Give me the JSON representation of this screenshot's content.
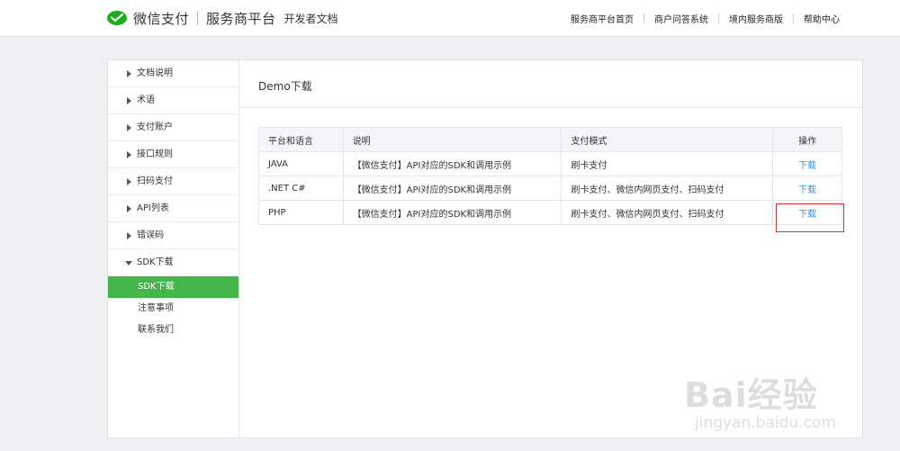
{
  "header": {
    "brand": "微信支付",
    "platform": "服务商平台",
    "docs": "开发者文档",
    "nav": [
      "服务商平台首页",
      "商户问答系统",
      "境内服务商版",
      "帮助中心"
    ]
  },
  "sidebar": {
    "items": [
      {
        "label": "文档说明"
      },
      {
        "label": "术语"
      },
      {
        "label": "支付账户"
      },
      {
        "label": "接口规则"
      },
      {
        "label": "扫码支付"
      },
      {
        "label": "API列表"
      },
      {
        "label": "错误码"
      },
      {
        "label": "SDK下载"
      }
    ],
    "sub_items": [
      {
        "label": "SDK下载"
      },
      {
        "label": "注意事项"
      },
      {
        "label": "联系我们"
      }
    ]
  },
  "main": {
    "title": "Demo下载",
    "table": {
      "headers": [
        "平台和语言",
        "说明",
        "支付模式",
        "操作"
      ],
      "rows": [
        {
          "platform": "JAVA",
          "desc": "【微信支付】API对应的SDK和调用示例",
          "mode": "刷卡支付",
          "action": "下载"
        },
        {
          "platform": ".NET C#",
          "desc": "【微信支付】API对应的SDK和调用示例",
          "mode": "刷卡支付、微信内网页支付、扫码支付",
          "action": "下载"
        },
        {
          "platform": "PHP",
          "desc": "【微信支付】API对应的SDK和调用示例",
          "mode": "刷卡支付、微信内网页支付、扫码支付",
          "action": "下载"
        }
      ]
    }
  },
  "watermark": {
    "text": "Bai经验",
    "sub": "jingyan.baidu.com"
  },
  "colors": {
    "accent_green": "#44b549",
    "link_blue": "#3b8fd8",
    "highlight_red": "#d9312e"
  }
}
